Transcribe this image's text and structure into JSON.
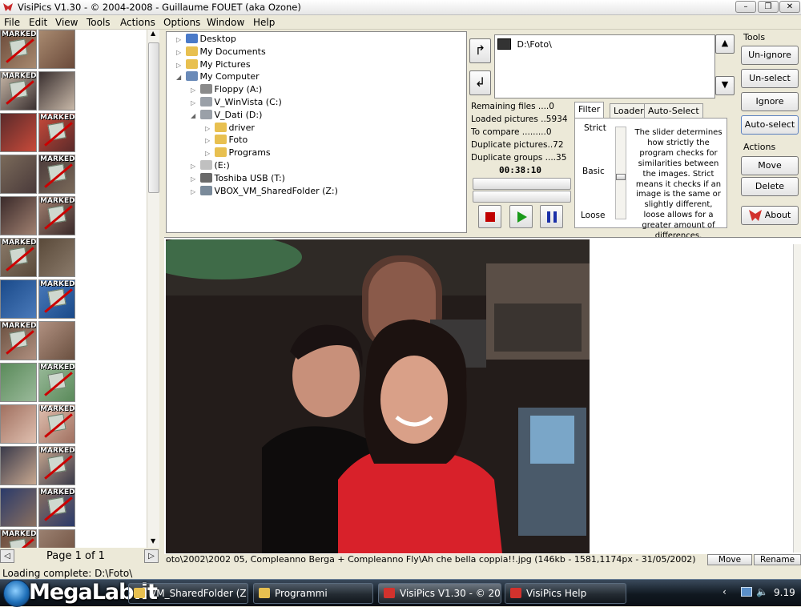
{
  "window": {
    "title": "VisiPics V1.30 - © 2004-2008 - Guillaume FOUET (aka Ozone)"
  },
  "menu": [
    "File",
    "Edit",
    "View",
    "Tools",
    "Actions",
    "Options",
    "Window",
    "Help"
  ],
  "thumbs": {
    "marked_label": "MARKED",
    "rows": [
      {
        "left_marked": true,
        "right_marked": false
      },
      {
        "left_marked": true,
        "right_marked": false
      },
      {
        "left_marked": false,
        "right_marked": true
      },
      {
        "left_marked": false,
        "right_marked": true
      },
      {
        "left_marked": false,
        "right_marked": true
      },
      {
        "left_marked": true,
        "right_marked": false
      },
      {
        "left_marked": false,
        "right_marked": true
      },
      {
        "left_marked": true,
        "right_marked": false
      },
      {
        "left_marked": false,
        "right_marked": true
      },
      {
        "left_marked": false,
        "right_marked": true
      },
      {
        "left_marked": false,
        "right_marked": true
      },
      {
        "left_marked": false,
        "right_marked": true
      },
      {
        "left_marked": true,
        "right_marked": false
      }
    ],
    "page_label": "Page 1 of 1"
  },
  "status": {
    "text": "Loading complete: D:\\Foto\\"
  },
  "tree": [
    {
      "label": "Desktop",
      "icon": "desktop-icon",
      "level": 0
    },
    {
      "label": "My Documents",
      "icon": "folder-icon",
      "level": 0
    },
    {
      "label": "My Pictures",
      "icon": "folder-icon",
      "level": 0
    },
    {
      "label": "My Computer",
      "icon": "computer-icon",
      "level": 0,
      "expanded": true
    },
    {
      "label": "Floppy (A:)",
      "icon": "floppy-icon",
      "level": 1
    },
    {
      "label": "V_WinVista (C:)",
      "icon": "drive-icon",
      "level": 1
    },
    {
      "label": "V_Dati (D:)",
      "icon": "drive-icon",
      "level": 1,
      "expanded": true
    },
    {
      "label": "driver",
      "icon": "folder-icon",
      "level": 2
    },
    {
      "label": "Foto",
      "icon": "folder-icon",
      "level": 2
    },
    {
      "label": "Programs",
      "icon": "folder-icon",
      "level": 2
    },
    {
      "label": "(E:)",
      "icon": "cdrom-icon",
      "level": 1
    },
    {
      "label": "Toshiba USB (T:)",
      "icon": "usb-drive-icon",
      "level": 1
    },
    {
      "label": "VBOX_VM_SharedFolder (Z:)",
      "icon": "network-drive-icon",
      "level": 1
    }
  ],
  "folders": {
    "selected": [
      "D:\\Foto\\"
    ]
  },
  "stats": {
    "remaining": "Remaining files ....0",
    "loaded": "Loaded pictures ..5934",
    "compare": "To compare .........0",
    "dup_pictures": "Duplicate pictures..72",
    "dup_groups": "Duplicate groups ....35",
    "timer": "00:38:10"
  },
  "tabs": [
    "Filter",
    "Loader",
    "Auto-Select"
  ],
  "filter": {
    "strict": "Strict",
    "basic": "Basic",
    "loose": "Loose",
    "description": "The slider determines how strictly the program checks for similarities between the images. Strict means it checks if an image is the same or slightly different, loose allows for a greater amount of differences.",
    "level_fraction": 0.55
  },
  "tools": {
    "heading": "Tools",
    "unignore": "Un-ignore",
    "unselect": "Un-select",
    "ignore_folder": "Ignore folder",
    "auto_select": "Auto-select"
  },
  "actions": {
    "heading": "Actions",
    "move": "Move",
    "delete": "Delete",
    "about": "About"
  },
  "preview": {
    "path": "oto\\2002\\2002 05, Compleanno Berga + Compleanno Fly\\Ah che bella coppia!!.jpg (146kb - 1581,1174px - 31/05/2002)",
    "move": "Move",
    "rename": "Rename"
  },
  "taskbar": {
    "items": [
      "VM_SharedFolder (Z:)",
      "Programmi",
      "VisiPics V1.30 - © 20...",
      "VisiPics Help"
    ],
    "clock": "9.19",
    "watermark": "MegaLab.it"
  },
  "colors": {
    "accent": "#316ac5",
    "marked": "#ffffff",
    "stop": "#c00000",
    "play": "#1a9a1a",
    "pause": "#1a2fa8"
  }
}
